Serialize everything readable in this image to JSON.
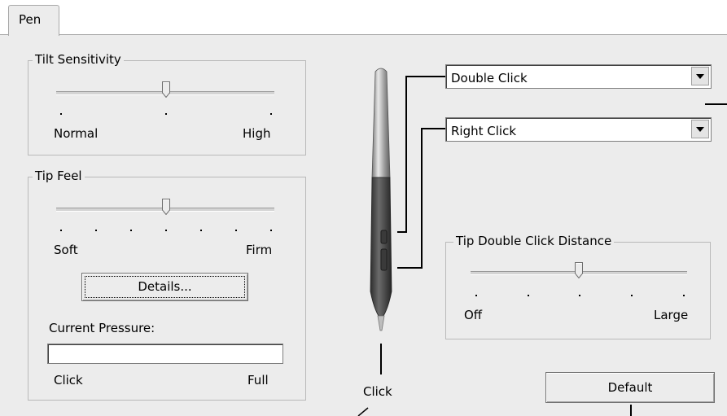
{
  "tabs": [
    {
      "label": "Pen"
    }
  ],
  "tilt": {
    "title": "Tilt Sensitivity",
    "min_label": "Normal",
    "max_label": "High",
    "value_fraction": 0.5
  },
  "tip_feel": {
    "title": "Tip Feel",
    "min_label": "Soft",
    "max_label": "Firm",
    "value_fraction": 0.5,
    "details_button": "Details...",
    "pressure_label": "Current Pressure:",
    "pressure_min": "Click",
    "pressure_max": "Full",
    "pressure_fraction": 0
  },
  "buttons": {
    "upper": {
      "value": "Double Click"
    },
    "lower": {
      "value": "Right Click"
    }
  },
  "tip_label": "Click",
  "double_click_distance": {
    "title": "Tip Double Click Distance",
    "min_label": "Off",
    "max_label": "Large",
    "value_fraction": 0.5
  },
  "default_button": "Default",
  "icons": [
    "pen-icon",
    "dropdown-arrow-icon",
    "slider-thumb-icon"
  ]
}
